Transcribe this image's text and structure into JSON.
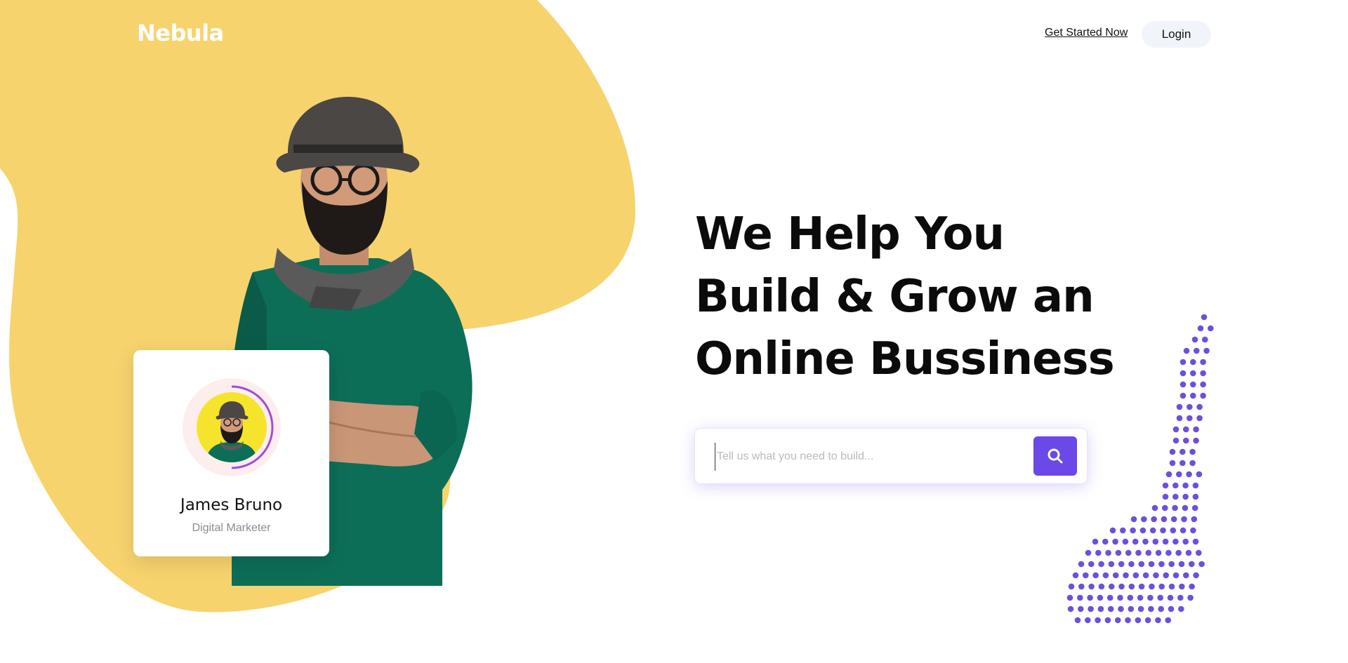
{
  "brand": {
    "name": "Nebula"
  },
  "nav": {
    "get_started_label": "Get Started Now",
    "login_label": "Login"
  },
  "hero": {
    "headline": [
      "We Help You",
      "Build & Grow an",
      "Online Bussiness"
    ],
    "search": {
      "placeholder": "Tell us what you need to build...",
      "value": "",
      "button_icon": "search-icon"
    }
  },
  "profile": {
    "name": "James Bruno",
    "role": "Digital Marketer"
  },
  "colors": {
    "blob": "#f7d36e",
    "accent": "#6b48e8",
    "dots": "#6d4fdc",
    "heading": "#0b0b0b"
  }
}
